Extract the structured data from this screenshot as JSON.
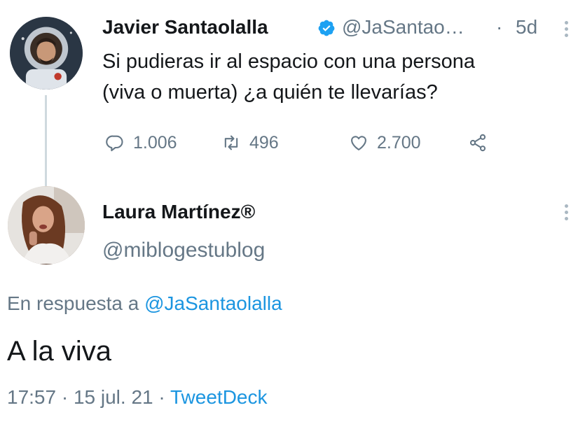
{
  "colors": {
    "text": "#14171a",
    "muted": "#657786",
    "link": "#1b95e0",
    "verified": "#1da1f2",
    "thread_line": "#cfd9de"
  },
  "tweet": {
    "author_name": "Javier Santaolalla",
    "verified": true,
    "handle": "@JaSantao…",
    "separator": "·",
    "time": "5d",
    "text_lines": [
      "Si pudieras ir al espacio con una persona",
      "(viva o muerta) ¿a quién te llevarías?"
    ],
    "actions": {
      "reply_icon": "reply-icon",
      "reply_count": "1.006",
      "retweet_icon": "retweet-icon",
      "retweet_count": "496",
      "like_icon": "heart-icon",
      "like_count": "2.700",
      "share_icon": "share-icon"
    }
  },
  "reply": {
    "author_name": "Laura Martínez®",
    "handle": "@miblogestublog",
    "in_reply_to_prefix": "En respuesta a",
    "in_reply_to_handle": "@JaSantaolalla",
    "text": "A la viva",
    "time": "17:57",
    "date": "15 jul. 21",
    "separator": "·",
    "source": "TweetDeck"
  }
}
